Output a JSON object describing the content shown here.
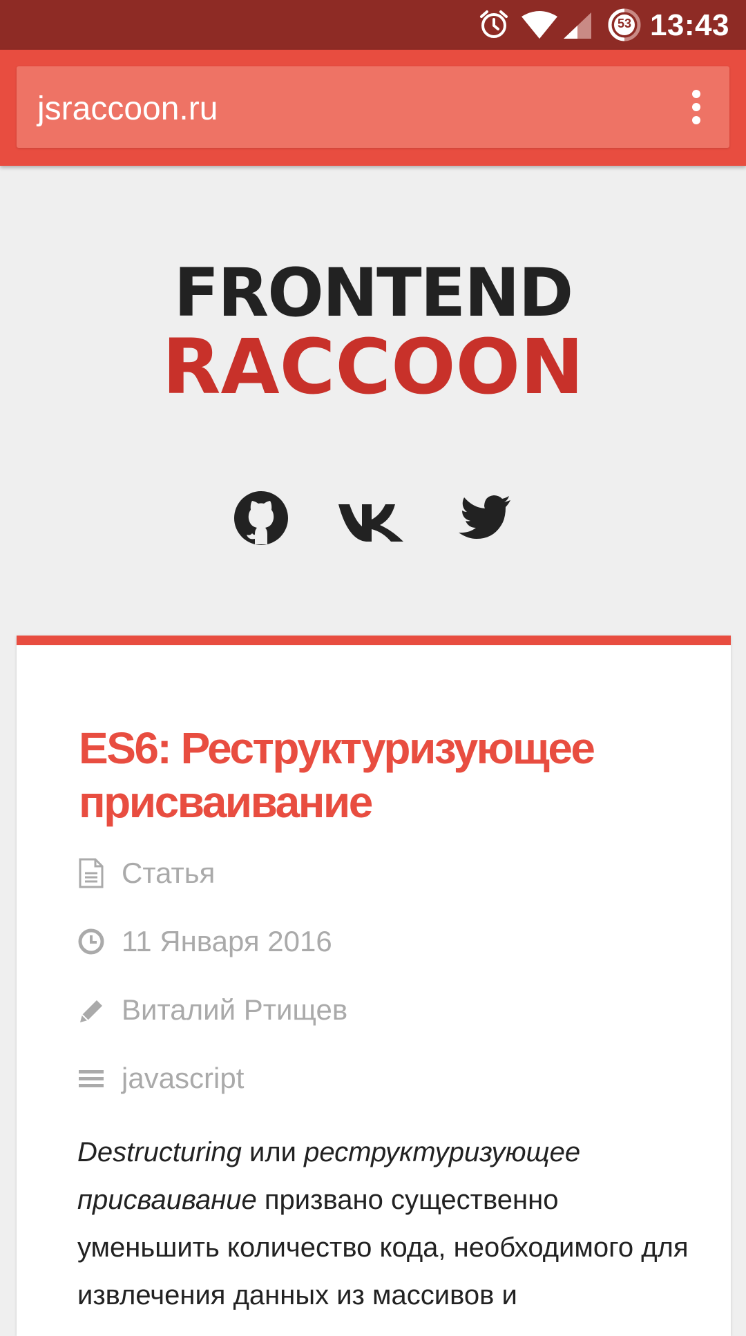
{
  "status_bar": {
    "time": "13:43",
    "battery_level": "53",
    "icons": [
      "alarm-icon",
      "wifi-icon",
      "signal-icon",
      "battery-icon"
    ]
  },
  "browser": {
    "url": "jsraccoon.ru",
    "menu_icon": "overflow-menu-icon"
  },
  "site": {
    "logo_line1": "FRONTEND",
    "logo_line2": "RACCOON",
    "social_icons": [
      "github-icon",
      "vk-icon",
      "twitter-icon"
    ]
  },
  "article": {
    "title": "ES6: Реструктуризующее присваивание",
    "meta": {
      "type": "Статья",
      "date": "11 Января 2016",
      "author": "Виталий Ртищев",
      "tag": "javascript"
    },
    "intro": {
      "term_en": "Destructuring",
      "connector": " или ",
      "term_ru": "реструктуризующее присваивание",
      "rest": " призвано существенно уменьшить количество кода, необходимого для извлечения данных из массивов и"
    }
  },
  "colors": {
    "status_bar": "#8e2b25",
    "toolbar": "#e84d40",
    "accent": "#e84d40",
    "logo_red": "#c8312a",
    "meta_gray": "#aaaaaa"
  }
}
